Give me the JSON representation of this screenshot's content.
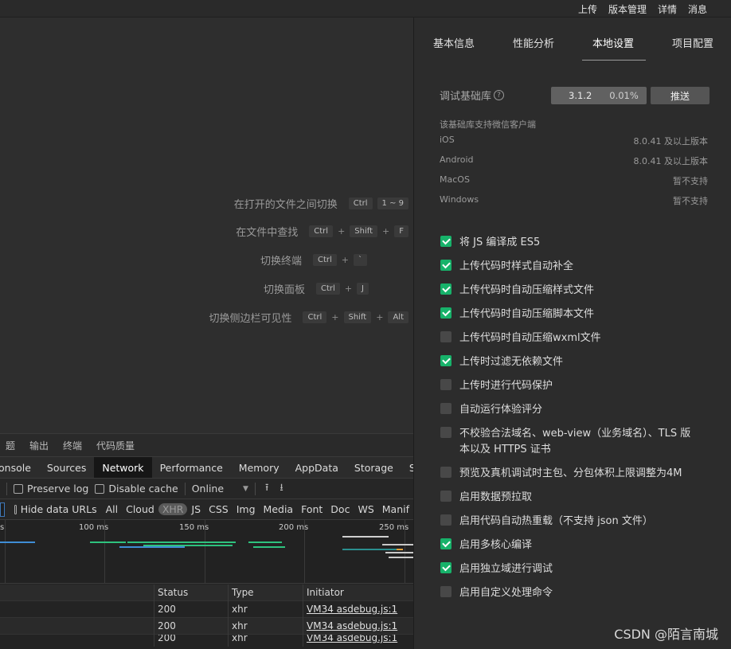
{
  "top_menu": [
    "上传",
    "版本管理",
    "详情",
    "消息"
  ],
  "shortcuts": [
    {
      "label": "在打开的文件之间切换",
      "keys": [
        "Ctrl",
        "1 ~ 9"
      ]
    },
    {
      "label": "在文件中查找",
      "keys": [
        "Ctrl",
        "Shift",
        "F"
      ]
    },
    {
      "label": "切换终端",
      "keys": [
        "Ctrl",
        "`"
      ]
    },
    {
      "label": "切换面板",
      "keys": [
        "Ctrl",
        "J"
      ]
    },
    {
      "label": "切换侧边栏可见性",
      "keys": [
        "Ctrl",
        "Shift",
        "Alt"
      ]
    }
  ],
  "key_plus": "+",
  "panel_tabs": [
    "题",
    "输出",
    "终端",
    "代码质量"
  ],
  "devtools_tabs": [
    "onsole",
    "Sources",
    "Network",
    "Performance",
    "Memory",
    "AppData",
    "Storage",
    "Security"
  ],
  "devtools_active_tab": "Network",
  "network_toolbar": {
    "preserve_log": "Preserve log",
    "disable_cache": "Disable cache",
    "throttle": "Online",
    "throttle_caret": "▼",
    "upload_icon": "⭱",
    "download_icon": "⭳"
  },
  "filter_bar": {
    "hide_data_urls": "Hide data URLs",
    "types": [
      "All",
      "Cloud",
      "XHR",
      "JS",
      "CSS",
      "Img",
      "Media",
      "Font",
      "Doc",
      "WS",
      "Manif"
    ],
    "selected": "XHR"
  },
  "timeline_ticks": [
    "s",
    "100 ms",
    "150 ms",
    "200 ms",
    "250 ms"
  ],
  "net_table": {
    "headers": [
      "Status",
      "Type",
      "Initiator"
    ],
    "rows": [
      [
        "200",
        "xhr",
        "VM34 asdebug.js:1"
      ],
      [
        "200",
        "xhr",
        "VM34 asdebug.js:1"
      ],
      [
        "200",
        "xhr",
        "VM34 asdebug.js:1"
      ]
    ]
  },
  "settings": {
    "tabs": [
      "基本信息",
      "性能分析",
      "本地设置",
      "项目配置"
    ],
    "active_tab": "本地设置",
    "lib_label": "调试基础库",
    "help_icon": "?",
    "lib_version": "3.1.2",
    "lib_usage": "0.01%",
    "push_label": "推送",
    "client_note": "该基础库支持微信客户端",
    "platforms": [
      {
        "name": "iOS",
        "value": "8.0.41 及以上版本"
      },
      {
        "name": "Android",
        "value": "8.0.41 及以上版本"
      },
      {
        "name": "MacOS",
        "value": "暂不支持"
      },
      {
        "name": "Windows",
        "value": "暂不支持"
      }
    ],
    "options": [
      {
        "label": "将 JS 编译成 ES5",
        "checked": true
      },
      {
        "label": "上传代码时样式自动补全",
        "checked": true
      },
      {
        "label": "上传代码时自动压缩样式文件",
        "checked": true
      },
      {
        "label": "上传代码时自动压缩脚本文件",
        "checked": true
      },
      {
        "label": "上传代码时自动压缩wxml文件",
        "checked": false
      },
      {
        "label": "上传时过滤无依赖文件",
        "checked": true
      },
      {
        "label": "上传时进行代码保护",
        "checked": false
      },
      {
        "label": "自动运行体验评分",
        "checked": false
      },
      {
        "label": "不校验合法域名、web-view（业务域名）、TLS 版本以及 HTTPS 证书",
        "checked": false
      },
      {
        "label": "预览及真机调试时主包、分包体积上限调整为4M",
        "checked": false
      },
      {
        "label": "启用数据预拉取",
        "checked": false
      },
      {
        "label": "启用代码自动热重载（不支持 json 文件）",
        "checked": false
      },
      {
        "label": "启用多核心编译",
        "checked": true
      },
      {
        "label": "启用独立域进行调试",
        "checked": true
      },
      {
        "label": "启用自定义处理命令",
        "checked": false
      }
    ]
  },
  "watermark": "CSDN @陌言南城",
  "colors": {
    "checked": "#17b26a",
    "accent_blue": "#3e78b9"
  }
}
